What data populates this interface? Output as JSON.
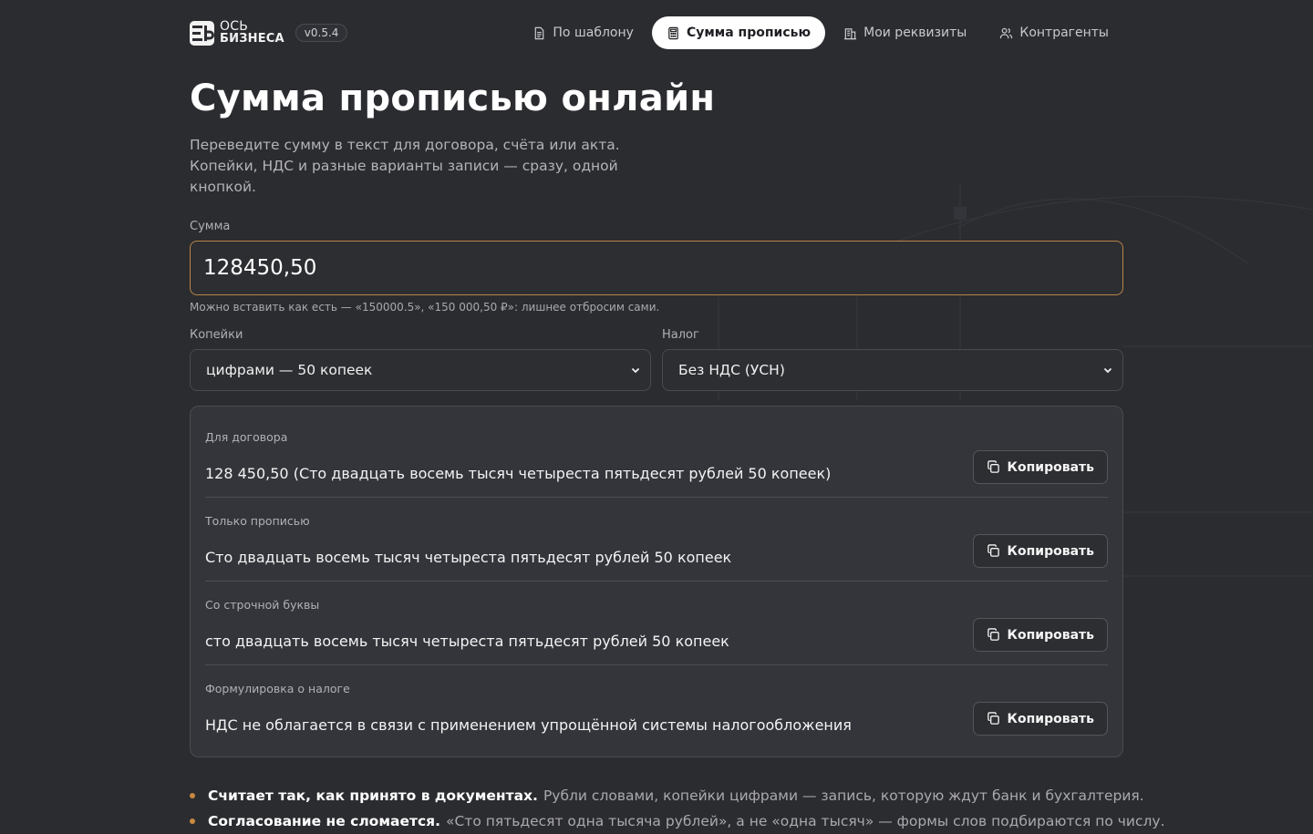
{
  "header": {
    "logo_line1": "ОСЬ",
    "logo_line2": "БИЗНЕСА",
    "version": "v0.5.4",
    "nav": [
      {
        "label": "По шаблону",
        "icon": "document-icon",
        "active": false
      },
      {
        "label": "Сумма прописью",
        "icon": "calculator-icon",
        "active": true
      },
      {
        "label": "Мои реквизиты",
        "icon": "building-icon",
        "active": false
      },
      {
        "label": "Контрагенты",
        "icon": "users-icon",
        "active": false
      }
    ]
  },
  "page": {
    "title": "Сумма прописью онлайн",
    "subtitle": "Переведите сумму в текст для договора, счёта или акта. Копейки, НДС и разные варианты записи — сразу, одной кнопкой."
  },
  "form": {
    "sum_label": "Сумма",
    "sum_value": "128450,50",
    "hint": "Можно вставить как есть — «150000.5», «150 000,50 ₽»: лишнее отбросим сами.",
    "kopecks_label": "Копейки",
    "kopecks_selected": "цифрами — 50 копеек",
    "tax_label": "Налог",
    "tax_selected": "Без НДС (УСН)"
  },
  "results": [
    {
      "label": "Для договора",
      "text": "128 450,50 (Сто двадцать восемь тысяч четыреста пятьдесят рублей 50 копеек)",
      "button": "Копировать"
    },
    {
      "label": "Только прописью",
      "text": "Сто двадцать восемь тысяч четыреста пятьдесят рублей 50 копеек",
      "button": "Копировать"
    },
    {
      "label": "Со строчной буквы",
      "text": "сто двадцать восемь тысяч четыреста пятьдесят рублей 50 копеек",
      "button": "Копировать"
    },
    {
      "label": "Формулировка о налоге",
      "text": "НДС не облагается в связи с применением упрощённой системы налогообложения",
      "button": "Копировать"
    }
  ],
  "features": [
    {
      "title": "Считает так, как принято в документах.",
      "text": "Рубли словами, копейки цифрами — запись, которую ждут банк и бухгалтерия."
    },
    {
      "title": "Согласование не сломается.",
      "text": "«Сто пятьдесят одна тысяча рублей», а не «одна тысяч» — формы слов подбираются по числу."
    }
  ],
  "colors": {
    "background": "#2b2c30",
    "accent": "#c98a3e",
    "input_border": "#b8864a",
    "card": "#34353b"
  }
}
